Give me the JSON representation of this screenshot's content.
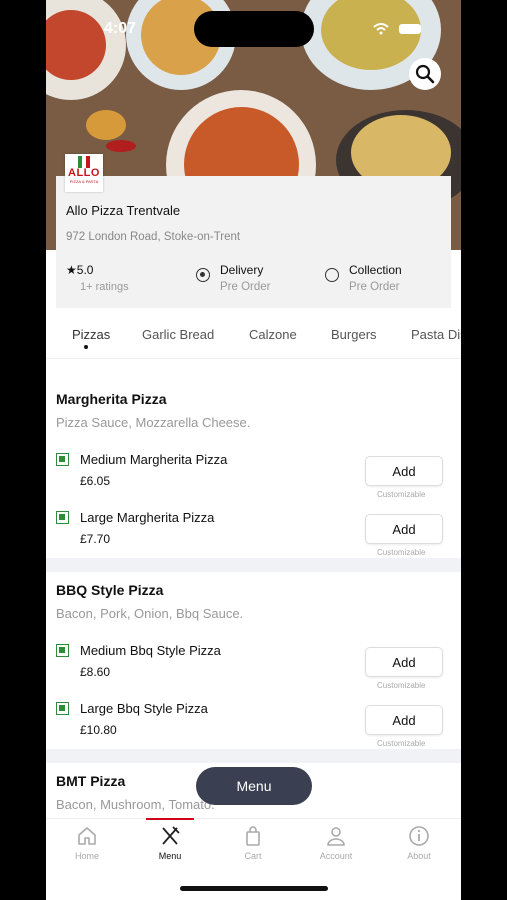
{
  "status": {
    "time": "4:07"
  },
  "restaurant": {
    "logo_text": "ALLO",
    "logo_sub": "PIZZA & PASTA",
    "name": "Allo Pizza Trentvale",
    "address": "972 London Road, Stoke-on-Trent",
    "rating": "5.0",
    "rating_count": "1+ ratings",
    "options": [
      {
        "label": "Delivery",
        "sub": "Pre Order",
        "selected": true
      },
      {
        "label": "Collection",
        "sub": "Pre Order",
        "selected": false
      }
    ]
  },
  "categories": [
    "Pizzas",
    "Garlic Bread",
    "Calzone",
    "Burgers",
    "Pasta Dishes"
  ],
  "sections": [
    {
      "title": "Margherita  Pizza",
      "desc": "Pizza Sauce, Mozzarella Cheese.",
      "items": [
        {
          "name": "Medium Margherita  Pizza",
          "price": "£6.05",
          "add": "Add",
          "note": "Customizable"
        },
        {
          "name": "Large Margherita  Pizza",
          "price": "£7.70",
          "add": "Add",
          "note": "Customizable"
        }
      ]
    },
    {
      "title": "BBQ Style  Pizza",
      "desc": "Bacon, Pork, Onion, Bbq  Sauce.",
      "items": [
        {
          "name": "Medium Bbq Style Pizza",
          "price": "£8.60",
          "add": "Add",
          "note": "Customizable"
        },
        {
          "name": "Large Bbq Style Pizza",
          "price": "£10.80",
          "add": "Add",
          "note": "Customizable"
        }
      ]
    },
    {
      "title": "BMT  Pizza",
      "desc": "Bacon, Mushroom, Tomato."
    }
  ],
  "fab_label": "Menu",
  "nav": [
    {
      "label": "Home",
      "icon": "home-icon"
    },
    {
      "label": "Menu",
      "icon": "fork-knife-icon",
      "active": true
    },
    {
      "label": "Cart",
      "icon": "bag-icon"
    },
    {
      "label": "Account",
      "icon": "user-icon"
    },
    {
      "label": "About",
      "icon": "info-icon"
    }
  ],
  "colors": {
    "accent": "#d0021b",
    "veg": "#2e8b3a",
    "fab": "#3a3f52"
  }
}
